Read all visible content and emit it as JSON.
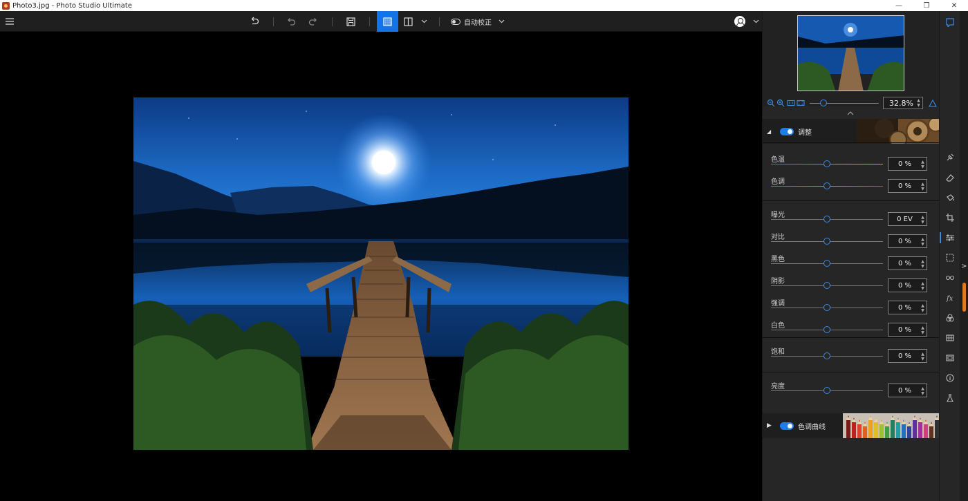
{
  "window": {
    "title": "Photo3.jpg - Photo Studio Ultimate",
    "min_icon": "minimize-icon",
    "max_icon": "restore-icon",
    "close_icon": "close-icon"
  },
  "toolbar": {
    "auto_correct_label": "自动校正",
    "icons": [
      "menu-icon",
      "revert-icon",
      "undo-icon",
      "redo-icon",
      "save-icon",
      "single-view-icon",
      "compare-view-icon",
      "chevron-down-icon",
      "toggle-icon",
      "account-icon"
    ]
  },
  "navigator": {
    "zoom_value": "32.8%",
    "zoom_level": 0.2
  },
  "adjust": {
    "title": "调整",
    "enabled": true,
    "groups": [
      {
        "rows": [
          {
            "label": "色温",
            "value": "0 %",
            "track": "temp"
          },
          {
            "label": "色调",
            "value": "0 %",
            "track": "tint"
          }
        ]
      },
      {
        "rows": [
          {
            "label": "曝光",
            "value": "0 EV"
          },
          {
            "label": "对比",
            "value": "0 %"
          },
          {
            "label": "黑色",
            "value": "0 %"
          },
          {
            "label": "阴影",
            "value": "0 %"
          },
          {
            "label": "强调",
            "value": "0 %"
          },
          {
            "label": "白色",
            "value": "0 %"
          }
        ]
      },
      {
        "rows": [
          {
            "label": "饱和",
            "value": "0 %"
          }
        ]
      },
      {
        "rows": [
          {
            "label": "亮度",
            "value": "0 %"
          }
        ]
      }
    ]
  },
  "tone_curve": {
    "title": "色调曲线",
    "enabled": true
  },
  "strip": {
    "icons": [
      "panels-icon",
      "pin-icon",
      "eraser-icon",
      "bucket-icon",
      "crop-icon",
      "sliders-icon",
      "selection-icon",
      "eyes-icon",
      "fx-icon",
      "color-mix-icon",
      "grid-icon",
      "frame-icon",
      "info-icon",
      "flask-icon"
    ]
  },
  "colors": {
    "accent": "#1473e6",
    "knob": "#3d8ae0",
    "scroll_accent": "#e07a1e"
  }
}
